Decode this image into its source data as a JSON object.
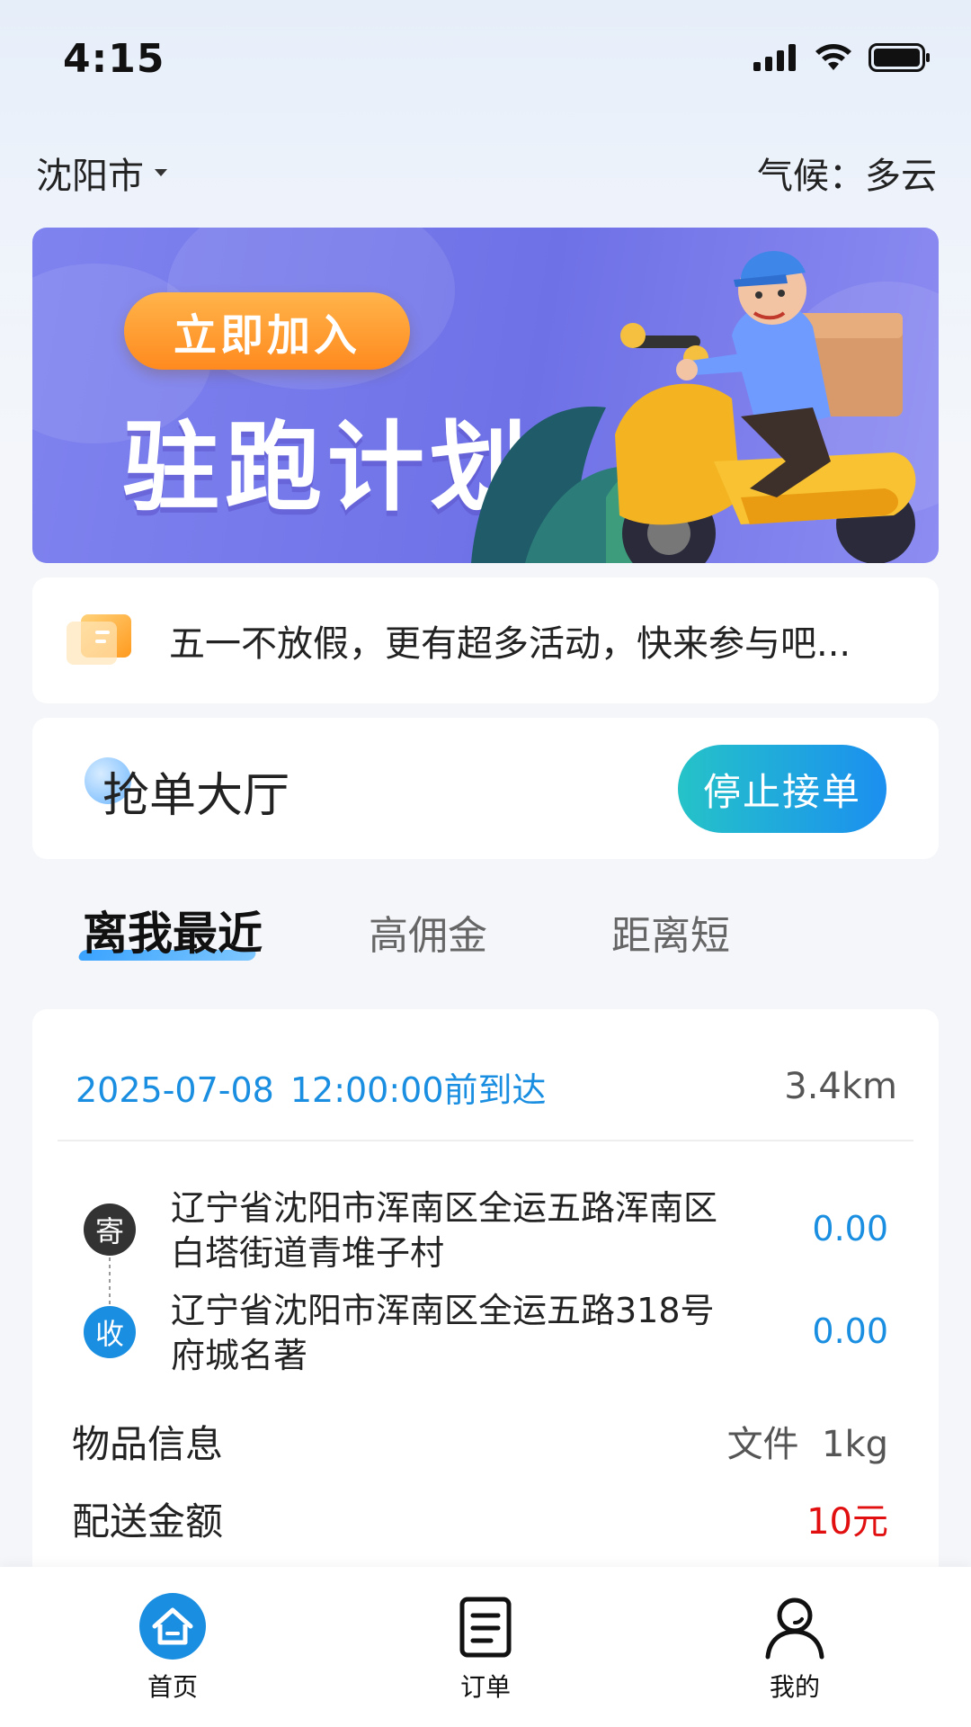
{
  "status_bar": {
    "time": "4:15"
  },
  "header": {
    "city": "沈阳市",
    "weather": "气候：多云"
  },
  "banner": {
    "button": "立即加入",
    "title": "驻跑计划"
  },
  "notice": {
    "text": "五一不放假，更有超多活动，快来参与吧..."
  },
  "hall": {
    "title": "抢单大厅",
    "stop_button": "停止接单"
  },
  "tabs": [
    {
      "label": "离我最近"
    },
    {
      "label": "高佣金"
    },
    {
      "label": "距离短"
    }
  ],
  "order": {
    "date": "2025-07-08",
    "arrival": "12:00:00前到达",
    "distance": "3.4km",
    "sender_badge": "寄",
    "sender_line1": "辽宁省沈阳市浑南区全运五路浑南区",
    "sender_line2": "白塔街道青堆子村",
    "sender_fee": "0.00",
    "receiver_badge": "收",
    "receiver_line1": "辽宁省沈阳市浑南区全运五路318号",
    "receiver_line2": "府城名著",
    "receiver_fee": "0.00",
    "item_label": "物品信息",
    "item_value": "文件  1kg",
    "fee_label": "配送金额",
    "fee_value": "10元"
  },
  "tabbar": [
    {
      "label": "首页"
    },
    {
      "label": "订单"
    },
    {
      "label": "我的"
    }
  ],
  "colors": {
    "accent": "#1a8ee0",
    "price_red": "#e10f0f",
    "banner": "#6e71e6"
  }
}
